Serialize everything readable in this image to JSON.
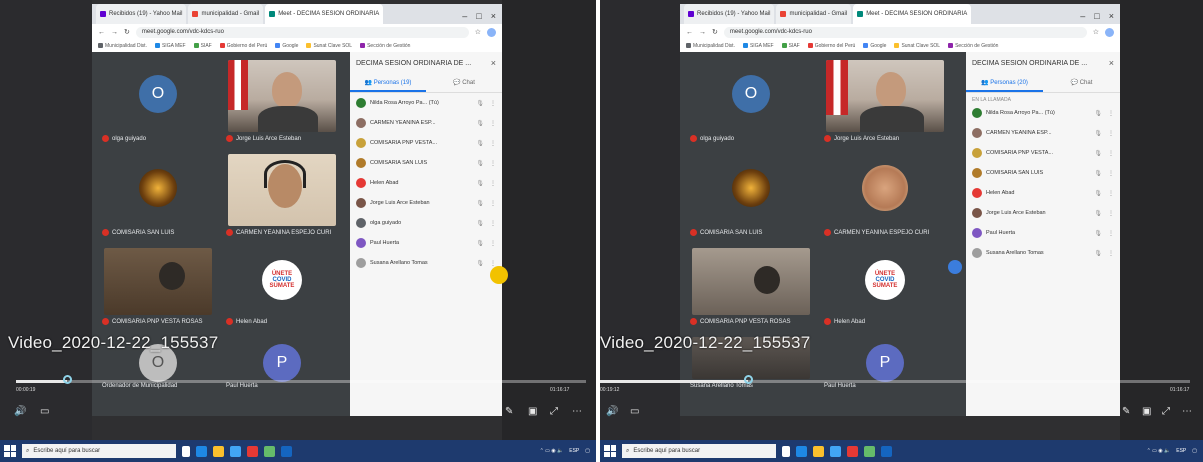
{
  "left": {
    "tabs": [
      "Recibidos (19) - Yahoo Mail",
      "municipalidad - Gmail",
      "Meet - DECIMA SESION ORDINARIA"
    ],
    "url": "meet.google.com/vdc-kdcs-ruo",
    "bookmarks": [
      "Municipalidad Dist.",
      "SIGA MEF",
      "SIAF",
      "Gobierno del Perú",
      "Google",
      "Sunat Clave SOL",
      "Sección de Gestión"
    ],
    "panel_title": "DECIMA SESION ORDINARIA DE ...",
    "tab_people": "Personas (19)",
    "tab_chat": "Chat",
    "participants": [
      {
        "name": "Nilda Rosa Arroyo Pa... (Tú)",
        "color": "#2e7d32",
        "initial": "N"
      },
      {
        "name": "CARMEN YEANINA ESP...",
        "color": "#8d6e63",
        "initial": ""
      },
      {
        "name": "COMISARIA PNP VESTA...",
        "color": "#c8a13a",
        "initial": ""
      },
      {
        "name": "COMISARIA SAN LUIS",
        "color": "#b07b2a",
        "initial": ""
      },
      {
        "name": "Helen Abad",
        "color": "#e53935",
        "initial": ""
      },
      {
        "name": "Jorge Luis Arce Esteban",
        "color": "#795548",
        "initial": ""
      },
      {
        "name": "olga guiyado",
        "color": "#5f6368",
        "initial": ""
      },
      {
        "name": "Paul Huerta",
        "color": "#7e57c2",
        "initial": ""
      },
      {
        "name": "Susana Arellano Tomas",
        "color": "#9e9e9e",
        "initial": ""
      }
    ],
    "tiles": [
      {
        "name": "olga guiyado",
        "initial": "O"
      },
      {
        "name": "Jorge Luis Arce Esteban"
      },
      {
        "name": "COMISARIA SAN LUIS"
      },
      {
        "name": "CARMEN YEANINA ESPEJO CURI"
      },
      {
        "name": "COMISARIA PNP VESTA ROSAS"
      },
      {
        "name": "Helen Abad"
      }
    ],
    "more_tiles": [
      {
        "name": "Ordenador de Municipalidad",
        "initial": "O"
      },
      {
        "name": "Paul Huerta",
        "initial": "P"
      }
    ],
    "video_title": "Video_2020-12-22_155537",
    "time_current": "00:00:19",
    "time_total": "01:16:17",
    "progress": 0.09,
    "search_placeholder": "Escribe aquí para buscar",
    "tray_time": "ESP"
  },
  "right": {
    "tabs": [
      "Recibidos (19) - Yahoo Mail",
      "municipalidad - Gmail",
      "Meet - DECIMA SESION ORDINARIA"
    ],
    "url": "meet.google.com/vdc-kdcs-ruo",
    "bookmarks": [
      "Municipalidad Dist.",
      "SIGA MEF",
      "SIAF",
      "Gobierno del Perú",
      "Google",
      "Sunat Clave SOL",
      "Sección de Gestión"
    ],
    "panel_title": "DECIMA SESION ORDINARIA DE ...",
    "tab_people": "Personas (20)",
    "tab_chat": "Chat",
    "section_label": "EN LA LLAMADA",
    "participants": [
      {
        "name": "Nilda Rosa Arroyo Pa... (Tú)",
        "color": "#2e7d32",
        "initial": "N"
      },
      {
        "name": "CARMEN YEANINA ESP...",
        "color": "#8d6e63",
        "initial": ""
      },
      {
        "name": "COMISARIA PNP VESTA...",
        "color": "#c8a13a",
        "initial": ""
      },
      {
        "name": "COMISARIA SAN LUIS",
        "color": "#b07b2a",
        "initial": ""
      },
      {
        "name": "Helen Abad",
        "color": "#e53935",
        "initial": ""
      },
      {
        "name": "Jorge Luis Arce Esteban",
        "color": "#795548",
        "initial": ""
      },
      {
        "name": "Paul Huerta",
        "color": "#7e57c2",
        "initial": ""
      },
      {
        "name": "Susana Arellano Tomas",
        "color": "#9e9e9e",
        "initial": ""
      }
    ],
    "tiles": [
      {
        "name": "olga guiyado",
        "initial": "O"
      },
      {
        "name": "Jorge Luis Arce Esteban"
      },
      {
        "name": "COMISARIA SAN LUIS"
      },
      {
        "name": "CARMEN YEANINA ESPEJO CURI"
      },
      {
        "name": "COMISARIA PNP VESTA ROSAS"
      },
      {
        "name": "Helen Abad"
      }
    ],
    "more_tiles": [
      {
        "name": "Susana Arellano Tomas",
        "initial": ""
      },
      {
        "name": "Paul Huerta",
        "initial": "P"
      }
    ],
    "video_title": "Video_2020-12-22_155537",
    "time_current": "00:19:12",
    "time_total": "01:16:17",
    "progress": 0.25,
    "search_placeholder": "Escribe aquí para buscar",
    "tray_time": "ESP"
  }
}
